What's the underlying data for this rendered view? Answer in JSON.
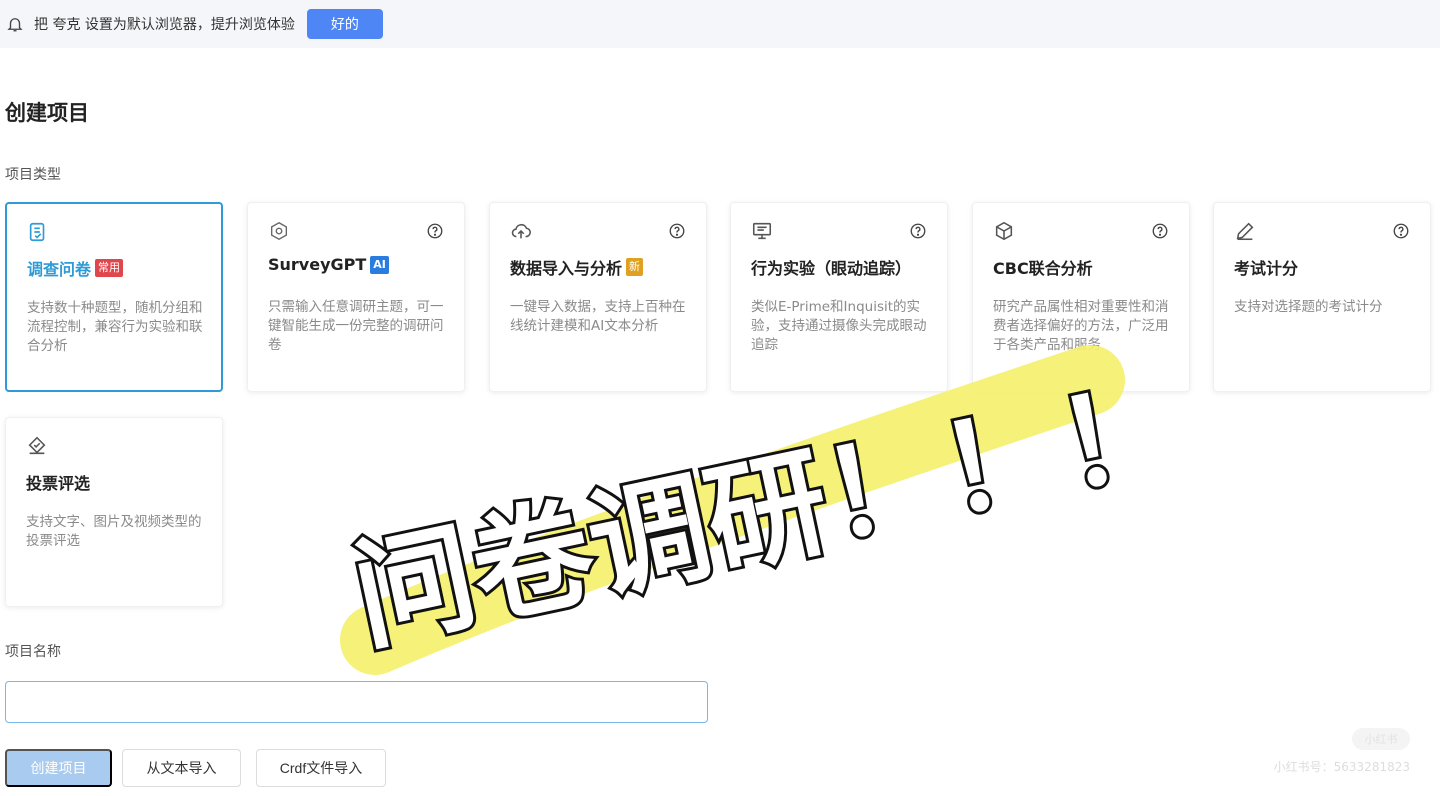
{
  "topbar": {
    "message": "把 夸克 设置为默认浏览器，提升浏览体验",
    "ok_label": "好的"
  },
  "page_title": "创建项目",
  "project_type_label": "项目类型",
  "cards": [
    {
      "title": "调查问卷",
      "badge": "常用",
      "badge_color": "#e0474c",
      "desc": "支持数十种题型，随机分组和流程控制，兼容行为实验和联合分析",
      "icon": "survey-icon",
      "selected": true
    },
    {
      "title": "SurveyGPT",
      "badge": "AI",
      "badge_color": "#2a7de0",
      "desc": "只需输入任意调研主题，可一键智能生成一份完整的调研问卷",
      "icon": "ai-chip-icon"
    },
    {
      "title": "数据导入与分析",
      "badge": "新",
      "badge_color": "#e0a020",
      "desc": "一键导入数据，支持上百种在线统计建模和AI文本分析",
      "icon": "cloud-upload-icon"
    },
    {
      "title": "行为实验（眼动追踪）",
      "desc": "类似E-Prime和Inquisit的实验，支持通过摄像头完成眼动追踪",
      "icon": "monitor-icon"
    },
    {
      "title": "CBC联合分析",
      "desc": "研究产品属性相对重要性和消费者选择偏好的方法，广泛用于各类产品和服务",
      "icon": "cube-icon"
    },
    {
      "title": "考试计分",
      "desc": "支持对选择题的考试计分",
      "icon": "pencil-icon"
    },
    {
      "title": "投票评选",
      "desc": "支持文字、图片及视频类型的投票评选",
      "icon": "vote-icon"
    }
  ],
  "project_name_label": "项目名称",
  "project_name_value": "",
  "buttons": {
    "create": "创建项目",
    "import_text": "从文本导入",
    "import_crdf": "Crdf文件导入"
  },
  "overlay_caption": "问卷调研！！！",
  "watermark": {
    "pill": "小红书",
    "text": "小红书号：5633281823"
  },
  "colors": {
    "accent": "#2f9bd6",
    "primary_button": "#4e86f5",
    "highlight_stroke": "#f4f06a"
  }
}
